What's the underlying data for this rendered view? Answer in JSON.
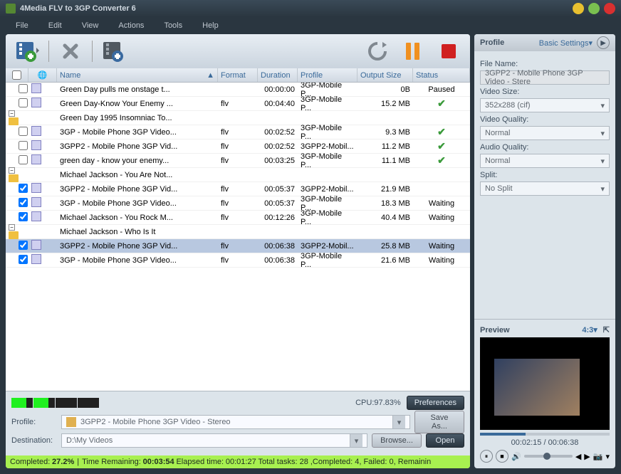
{
  "app": {
    "title": "4Media FLV to 3GP Converter 6"
  },
  "menu": {
    "file": "File",
    "edit": "Edit",
    "view": "View",
    "actions": "Actions",
    "tools": "Tools",
    "help": "Help"
  },
  "columns": {
    "name": "Name",
    "format": "Format",
    "duration": "Duration",
    "profile": "Profile",
    "output": "Output Size",
    "status": "Status"
  },
  "rows": [
    {
      "type": "file",
      "name": "Green Day pulls me onstage t...",
      "format": "",
      "duration": "00:00:00",
      "profile": "3GP-Mobile P...",
      "output": "0B",
      "status": "Paused",
      "checked": false
    },
    {
      "type": "file",
      "name": "Green Day-Know Your Enemy ...",
      "format": "flv",
      "duration": "00:04:40",
      "profile": "3GP-Mobile P...",
      "output": "15.2 MB",
      "status": "check",
      "checked": false
    },
    {
      "type": "group",
      "name": "Green Day 1995 Insomniac To..."
    },
    {
      "type": "child",
      "name": "3GP - Mobile Phone 3GP Video...",
      "format": "flv",
      "duration": "00:02:52",
      "profile": "3GP-Mobile P...",
      "output": "9.3 MB",
      "status": "check",
      "checked": false
    },
    {
      "type": "child",
      "name": "3GPP2 - Mobile Phone 3GP Vid...",
      "format": "flv",
      "duration": "00:02:52",
      "profile": "3GPP2-Mobil...",
      "output": "11.2 MB",
      "status": "check",
      "checked": false
    },
    {
      "type": "file",
      "name": "green day - know your enemy...",
      "format": "flv",
      "duration": "00:03:25",
      "profile": "3GP-Mobile P...",
      "output": "11.1 MB",
      "status": "check",
      "checked": false
    },
    {
      "type": "group",
      "name": "Michael Jackson - You Are Not..."
    },
    {
      "type": "child",
      "name": "3GPP2 - Mobile Phone 3GP Vid...",
      "format": "flv",
      "duration": "00:05:37",
      "profile": "3GPP2-Mobil...",
      "output": "21.9 MB",
      "status": "",
      "checked": true
    },
    {
      "type": "child",
      "name": "3GP - Mobile Phone 3GP Video...",
      "format": "flv",
      "duration": "00:05:37",
      "profile": "3GP-Mobile P...",
      "output": "18.3 MB",
      "status": "Waiting",
      "checked": true
    },
    {
      "type": "file",
      "name": "Michael Jackson - You Rock M...",
      "format": "flv",
      "duration": "00:12:26",
      "profile": "3GP-Mobile P...",
      "output": "40.4 MB",
      "status": "Waiting",
      "checked": true
    },
    {
      "type": "group",
      "name": "Michael Jackson - Who Is It"
    },
    {
      "type": "child",
      "name": "3GPP2 - Mobile Phone 3GP Vid...",
      "format": "flv",
      "duration": "00:06:38",
      "profile": "3GPP2-Mobil...",
      "output": "25.8 MB",
      "status": "Waiting",
      "checked": true,
      "selected": true
    },
    {
      "type": "child",
      "name": "3GP - Mobile Phone 3GP Video...",
      "format": "flv",
      "duration": "00:06:38",
      "profile": "3GP-Mobile P...",
      "output": "21.6 MB",
      "status": "Waiting",
      "checked": true
    }
  ],
  "cpu": {
    "label": "CPU:97.83%",
    "pref_btn": "Preferences"
  },
  "form": {
    "profile_label": "Profile:",
    "profile_value": "3GPP2 - Mobile Phone 3GP Video - Stereo",
    "save_as": "Save As...",
    "dest_label": "Destination:",
    "dest_value": "D:\\My Videos",
    "browse": "Browse...",
    "open": "Open"
  },
  "status": {
    "completed_label": "Completed:",
    "completed_pct": "27.2%",
    "time_remain_label": "Time Remaining:",
    "time_remain": "00:03:54",
    "elapsed_label": "Elapsed time:",
    "elapsed": "00:01:27",
    "tasks": "Total tasks: 28 ,Completed: 4, Failed: 0, Remainin"
  },
  "side": {
    "profile_header": "Profile",
    "basic": "Basic Settings",
    "filename_label": "File Name:",
    "filename": "3GPP2 - Mobile Phone 3GP Video - Stere",
    "videosize_label": "Video Size:",
    "videosize": "352x288 (cif)",
    "vq_label": "Video Quality:",
    "vq": "Normal",
    "aq_label": "Audio Quality:",
    "aq": "Normal",
    "split_label": "Split:",
    "split": "No Split"
  },
  "preview": {
    "header": "Preview",
    "ratio": "4:3",
    "time": "00:02:15 / 00:06:38"
  }
}
